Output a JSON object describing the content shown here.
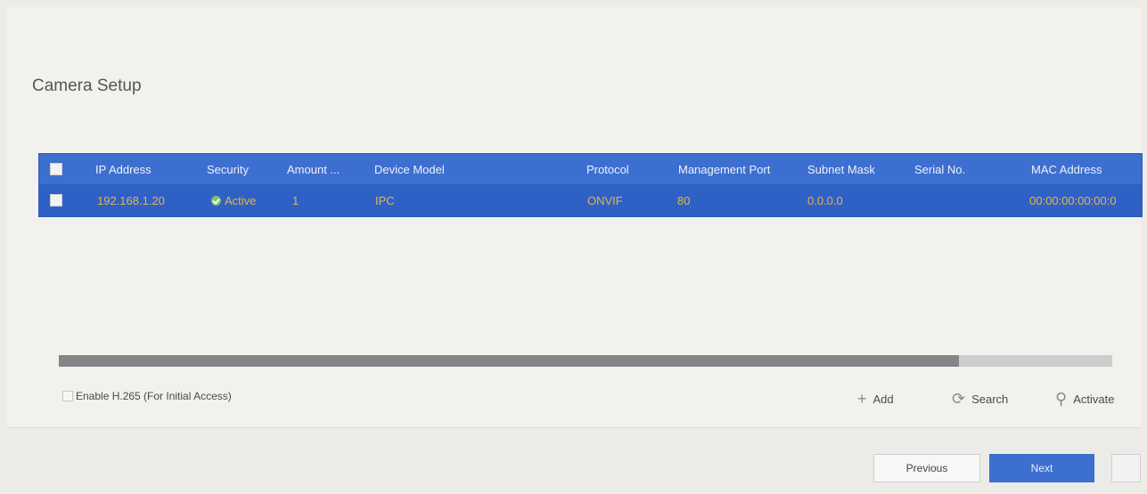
{
  "page": {
    "title": "Camera Setup"
  },
  "table": {
    "columns": [
      "IP Address",
      "Security",
      "Amount ...",
      "Device Model",
      "Protocol",
      "Management Port",
      "Subnet Mask",
      "Serial No.",
      "MAC Address"
    ],
    "rows": [
      {
        "ip": "192.168.1.20",
        "security": "Active",
        "amount": "1",
        "model": "IPC",
        "protocol": "ONVIF",
        "port": "80",
        "subnet": "0.0.0.0",
        "serial": "",
        "mac": "00:00:00:00:00:0"
      }
    ]
  },
  "scrollbar": {
    "position_fraction": 0.855
  },
  "options": {
    "enable_h265_label": "Enable H.265 (For Initial Access)"
  },
  "actions": {
    "add_label": "Add",
    "search_label": "Search",
    "activate_label": "Activate"
  },
  "footer": {
    "previous_label": "Previous",
    "next_label": "Next"
  },
  "colors": {
    "table_header": "#3d6fd0",
    "table_row": "#2f60c6",
    "row_text": "#e1b64a",
    "primary_button": "#3d6fd0"
  },
  "icons": {
    "add": "plus-icon",
    "search": "refresh-icon",
    "activate": "key-icon",
    "security": "check-shield-icon"
  }
}
